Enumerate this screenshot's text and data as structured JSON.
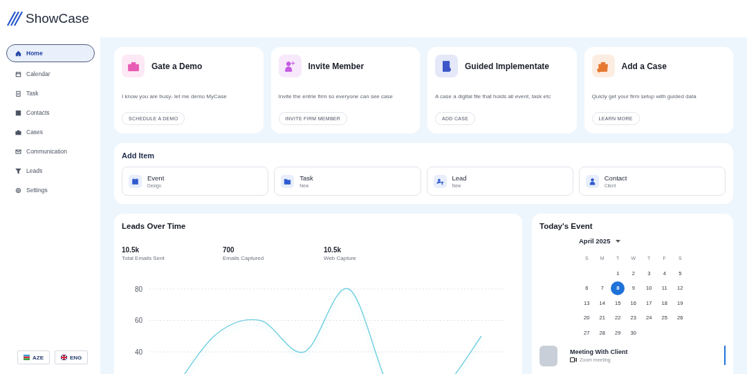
{
  "brand": {
    "name": "ShowCase"
  },
  "sidebar": {
    "items": [
      {
        "label": "Home",
        "selected": true
      },
      {
        "label": "Calendar",
        "selected": false
      },
      {
        "label": "Task",
        "selected": false
      },
      {
        "label": "Contacts",
        "selected": false
      },
      {
        "label": "Cases",
        "selected": false
      },
      {
        "label": "Communication",
        "selected": false
      },
      {
        "label": "Leads",
        "selected": false
      },
      {
        "label": "Settings",
        "selected": false
      }
    ],
    "languages": [
      "AZE",
      "ENG"
    ]
  },
  "quick_cards": [
    {
      "title": "Gate a Demo",
      "color": "#e75cb4",
      "description": "I know you are busy- let me demo MyCase",
      "button": "SCHEDULE A DEMO"
    },
    {
      "title": "Invite Member",
      "color": "#c45be0",
      "description": "Invite the entrie firm so everyone can see case",
      "button": "INVITE FIRM MEMBER"
    },
    {
      "title": "Guided Implementate",
      "color": "#3d55c8",
      "description": "A case a digital file that holds all event, task etc",
      "button": "ADD CASE"
    },
    {
      "title": "Add a Case",
      "color": "#e5792f",
      "description": "Quicly get your firm setup with guided data",
      "button": "LEARN MORE"
    }
  ],
  "add_item": {
    "title": "Add Item",
    "items": [
      {
        "label": "Event",
        "sublabel": "Design"
      },
      {
        "label": "Task",
        "sublabel": "New"
      },
      {
        "label": "Lead",
        "sublabel": "New"
      },
      {
        "label": "Contact",
        "sublabel": "Client"
      }
    ]
  },
  "leads_over_time": {
    "title": "Leads Over Time",
    "stats": [
      {
        "value": "10.5k",
        "label": "Total Emails Sent"
      },
      {
        "value": "700",
        "label": "Emails Captured"
      },
      {
        "value": "10.5k",
        "label": "Web Capture"
      }
    ],
    "chart_data": {
      "type": "line",
      "grid": true,
      "ylim": [
        40,
        80
      ],
      "yticks": [
        40,
        60,
        80
      ],
      "series": [
        {
          "color": "#6fcfe0",
          "values": [
            null,
            51,
            60,
            40,
            80,
            null,
            null,
            50
          ]
        }
      ]
    }
  },
  "todays_event": {
    "title": "Today's Event",
    "month": "April 2025",
    "weekdays": [
      "S",
      "M",
      "T",
      "W",
      "T",
      "F",
      "S"
    ],
    "weeks": [
      [
        {
          "day": "1",
          "selected": false
        },
        {
          "day": "2",
          "selected": false
        },
        {
          "day": "3",
          "selected": false
        },
        {
          "day": "4",
          "selected": false
        },
        {
          "day": "5",
          "selected": false
        }
      ],
      [
        {
          "day": "6",
          "selected": false
        },
        {
          "day": "7",
          "selected": false
        },
        {
          "day": "8",
          "selected": true
        },
        {
          "day": "9",
          "selected": false
        },
        {
          "day": "10",
          "selected": false
        },
        {
          "day": "11",
          "selected": false
        },
        {
          "day": "12",
          "selected": false
        }
      ],
      [
        {
          "day": "13",
          "selected": false
        },
        {
          "day": "14",
          "selected": false
        },
        {
          "day": "15",
          "selected": false
        },
        {
          "day": "16",
          "selected": false
        },
        {
          "day": "17",
          "selected": false
        },
        {
          "day": "18",
          "selected": false
        },
        {
          "day": "19",
          "selected": false
        }
      ],
      [
        {
          "day": "20",
          "selected": false
        },
        {
          "day": "21",
          "selected": false
        },
        {
          "day": "22",
          "selected": false
        },
        {
          "day": "23",
          "selected": false
        },
        {
          "day": "24",
          "selected": false
        },
        {
          "day": "25",
          "selected": false
        },
        {
          "day": "26",
          "selected": false
        }
      ],
      [
        {
          "day": "27",
          "selected": false
        },
        {
          "day": "28",
          "selected": false
        },
        {
          "day": "29",
          "selected": false
        },
        {
          "day": "30",
          "selected": false
        }
      ]
    ],
    "events": [
      {
        "title": "Meeting With Client",
        "location": "Zoom meeting"
      }
    ]
  }
}
